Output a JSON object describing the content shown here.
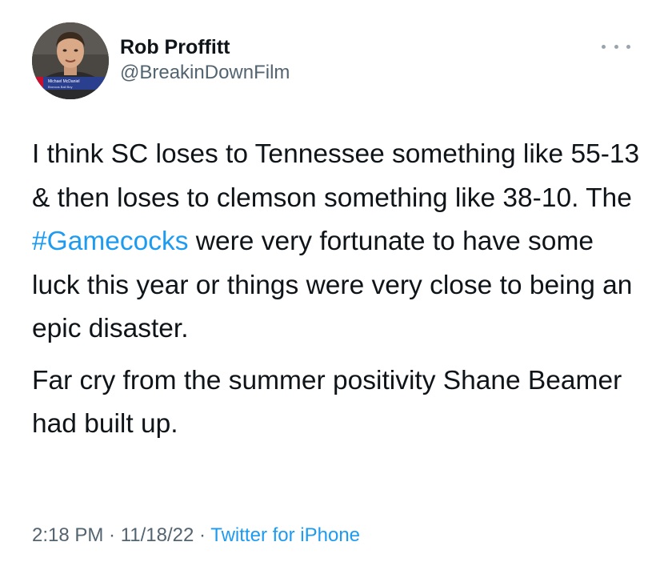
{
  "author": {
    "display_name": "Rob Proffitt",
    "handle": "@BreakinDownFilm",
    "avatar_caption_line1": "Michael McDaniel",
    "avatar_caption_line2": "Broncos Ball Boy"
  },
  "tweet": {
    "text_before_hashtag": "I think SC loses to Tennessee something like 55-13 & then loses to clemson something like 38-10. The ",
    "hashtag": "#Gamecocks",
    "text_after_hashtag": " were very fortunate to have some luck this year or things were very close to being an epic disaster.",
    "paragraph2": "Far cry from the summer positivity Shane Beamer had built up."
  },
  "meta": {
    "time": "2:18 PM",
    "separator": " · ",
    "date": "11/18/22",
    "source": "Twitter for iPhone"
  },
  "icons": {
    "more": "more-options-icon"
  },
  "colors": {
    "text_primary": "#0f1419",
    "text_secondary": "#536471",
    "link": "#1d9bf0"
  }
}
